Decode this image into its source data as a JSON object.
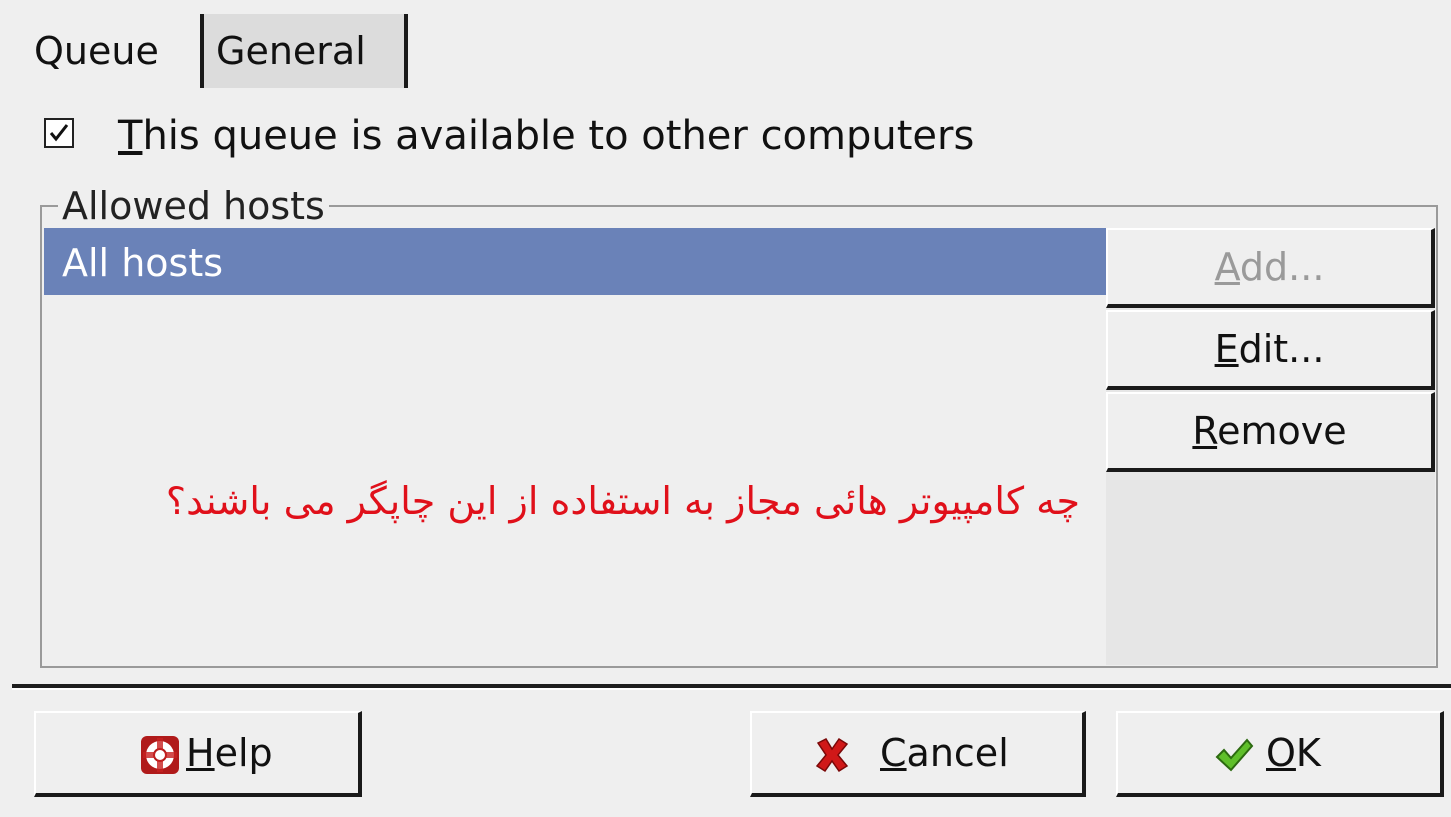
{
  "tabs": {
    "queue_label": "Queue",
    "general_label": "General"
  },
  "sharing": {
    "checked": true,
    "label_accel": "T",
    "label_rest": "his queue is available to other computers"
  },
  "allowed_hosts": {
    "group_label": "Allowed hosts",
    "items": [
      "All hosts"
    ],
    "annotation": "چه کامپیوتر هائی مجاز به استفاده از این چاپگر می باشند؟"
  },
  "side_buttons": {
    "add": {
      "accel": "A",
      "rest": "dd...",
      "enabled": false
    },
    "edit": {
      "accel": "E",
      "rest": "dit..."
    },
    "remove": {
      "accel": "R",
      "rest": "emove"
    }
  },
  "footer": {
    "help": {
      "accel": "H",
      "rest": "elp",
      "icon": "lifebuoy-icon"
    },
    "cancel": {
      "accel": "C",
      "rest": "ancel",
      "icon": "red-x-icon"
    },
    "ok": {
      "accel": "O",
      "rest": "K",
      "icon": "green-check-icon"
    }
  },
  "colors": {
    "selection": "#6a82b8",
    "annotation": "#e0101a",
    "background": "#efefef"
  }
}
